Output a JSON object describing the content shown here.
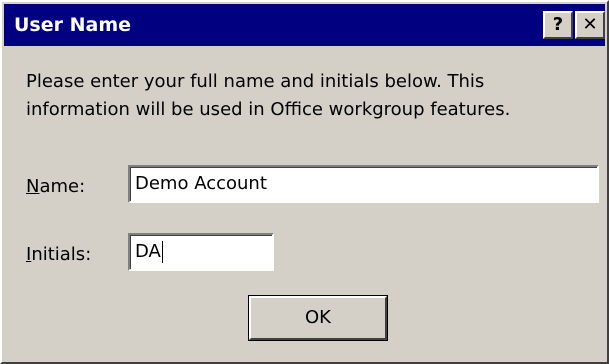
{
  "window": {
    "title": "User Name",
    "help_button": "?",
    "close_button": "✕"
  },
  "message": {
    "line1": "Please enter your full name and initials below.  This",
    "line2": "information will be used in Office workgroup features."
  },
  "fields": {
    "name": {
      "label_accel": "N",
      "label_rest": "ame:",
      "value": "Demo Account"
    },
    "initials": {
      "label_accel": "I",
      "label_rest": "nitials:",
      "value": "DA"
    }
  },
  "buttons": {
    "ok": "OK"
  }
}
